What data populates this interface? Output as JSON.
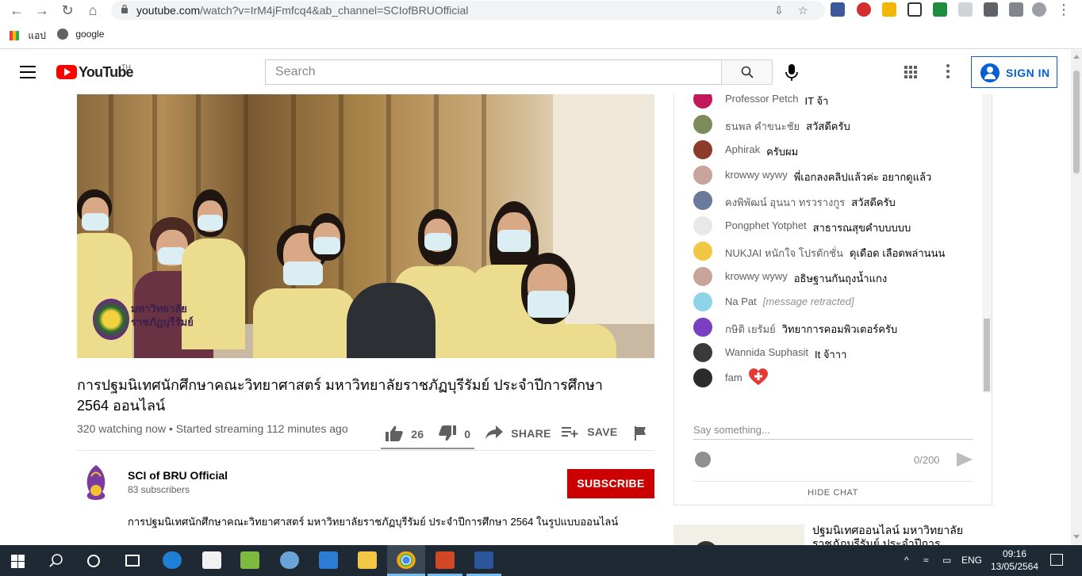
{
  "browser": {
    "url_main": "youtube.com",
    "url_rest": "/watch?v=IrM4jFmfcq4&ab_channel=SCIofBRUOfficial",
    "bookmarks": [
      {
        "label": "แอป",
        "icon": "apps-grid-icon"
      },
      {
        "label": "google",
        "icon": "globe-icon"
      }
    ]
  },
  "header": {
    "logo_text": "YouTube",
    "country": "TH",
    "search_placeholder": "Search",
    "signin_label": "SIGN IN"
  },
  "video": {
    "overlay_logo_text": "มหาวิทยาลัย ราชภัฏบุรีรัมย์",
    "title": "การปฐมนิเทศนักศึกษาคณะวิทยาศาสตร์ มหาวิทยาลัยราชภัฏบุรีรัมย์ ประจำปีการศึกษา 2564 ออนไลน์",
    "meta": "320 watching now • Started streaming 112 minutes ago",
    "likes": "26",
    "dislikes": "0",
    "share_label": "SHARE",
    "save_label": "SAVE"
  },
  "channel": {
    "name": "SCI of BRU Official",
    "subscribers": "83 subscribers",
    "subscribe_label": "SUBSCRIBE",
    "description": "การปฐมนิเทศนักศึกษาคณะวิทยาศาสตร์ มหาวิทยาลัยราชภัฏบุรีรัมย์ ประจำปีการศึกษา 2564 ในรูปแบบออนไลน์"
  },
  "chat": {
    "messages": [
      {
        "name": "Professor Petch",
        "text": "IT จ้า",
        "color": "#c2185b"
      },
      {
        "name": "ธนพล คำขนะชัย",
        "text": "สวัสดีครับ",
        "color": "#7c8b5a"
      },
      {
        "name": "Aphirak",
        "text": "ครับผม",
        "color": "#8d3a2a"
      },
      {
        "name": "krowwy wywy",
        "text": "พี่เอกลงคลิปแล้วค่ะ อยากดูแล้ว",
        "color": "#c9a49a"
      },
      {
        "name": "คงพิพัฒน์ อุนนา ทรวรางกูร",
        "text": "สวัสดีครับ",
        "color": "#6a7a9a"
      },
      {
        "name": "Pongphet Yotphet",
        "text": "สาธารณสุขคำบบบบบ",
        "color": "#e8e8e8"
      },
      {
        "name": "NUKJAI หนักใจ โปรดักชั่น",
        "text": "ดุเดือด เลือดพล่านนน",
        "color": "#f2c744"
      },
      {
        "name": "krowwy wywy",
        "text": "อธิษฐานกันถุงน้ำแกง",
        "color": "#c9a49a"
      },
      {
        "name": "Na Pat",
        "text": "[message retracted]",
        "color": "#8fd3e8",
        "retracted": true
      },
      {
        "name": "กษิติ เยรัมย์",
        "text": "วิทยาการคอมพิวเตอร์ครับ",
        "color": "#7b3fc4"
      },
      {
        "name": "Wannida Suphasit",
        "text": "It จ้าาา",
        "color": "#3a3a3a"
      },
      {
        "name": "fam",
        "text": "",
        "color": "#2b2b2b",
        "heart": true
      }
    ],
    "input_placeholder": "Say something...",
    "counter": "0/200",
    "hide_label": "HIDE CHAT"
  },
  "recommended": {
    "title": "ปฐมนิเทศออนไลน์ มหาวิทยาลัยราชภัฏบุรีรัมย์ ประจำปีการ"
  },
  "taskbar": {
    "lang": "ENG",
    "time": "09:16",
    "date": "13/05/2564"
  }
}
